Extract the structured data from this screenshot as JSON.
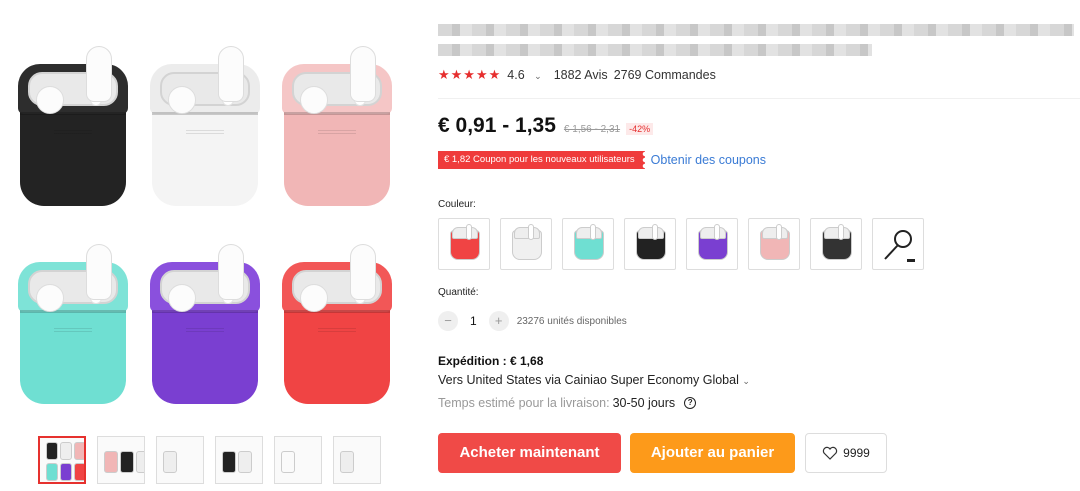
{
  "gallery": {
    "cases": [
      {
        "name": "black",
        "body": "#232323",
        "rim": "#2d2d2d"
      },
      {
        "name": "white",
        "body": "#f4f4f4",
        "rim": "#ececec"
      },
      {
        "name": "pink",
        "body": "#f1b6b6",
        "rim": "#f5c6c6"
      },
      {
        "name": "mint",
        "body": "#6fdfd2",
        "rim": "#7ee3d7"
      },
      {
        "name": "purple",
        "body": "#7a3fd1",
        "rim": "#8a50dd"
      },
      {
        "name": "red",
        "body": "#f04444",
        "rim": "#f25757"
      }
    ],
    "thumbnail_count": 6
  },
  "product": {
    "rating": "4.6",
    "reviews": "1882 Avis",
    "orders": "2769 Commandes",
    "price": "€ 0,91 - 1,35",
    "old_price": "€ 1,56 - 2,31",
    "discount": "-42%",
    "coupon": "€ 1,82 Coupon pour les nouveaux utilisateurs",
    "coupon_link": "Obtenir des coupons"
  },
  "options": {
    "color_label": "Couleur:",
    "colors": [
      "#f04444",
      "#f0f0f0",
      "#6fdfd2",
      "#222222",
      "#7a3fd1",
      "#f1b6b6",
      "#333333"
    ],
    "quantity_label": "Quantité:",
    "quantity": "1",
    "stock": "23276 unités disponibles"
  },
  "shipping": {
    "title": "Expédition : € 1,68",
    "via": "Vers United States via Cainiao Super Economy Global",
    "time_label": "Temps estimé pour la livraison:",
    "time_value": "30-50 jours"
  },
  "actions": {
    "buy": "Acheter maintenant",
    "cart": "Ajouter au panier",
    "wishlist_count": "9999"
  }
}
